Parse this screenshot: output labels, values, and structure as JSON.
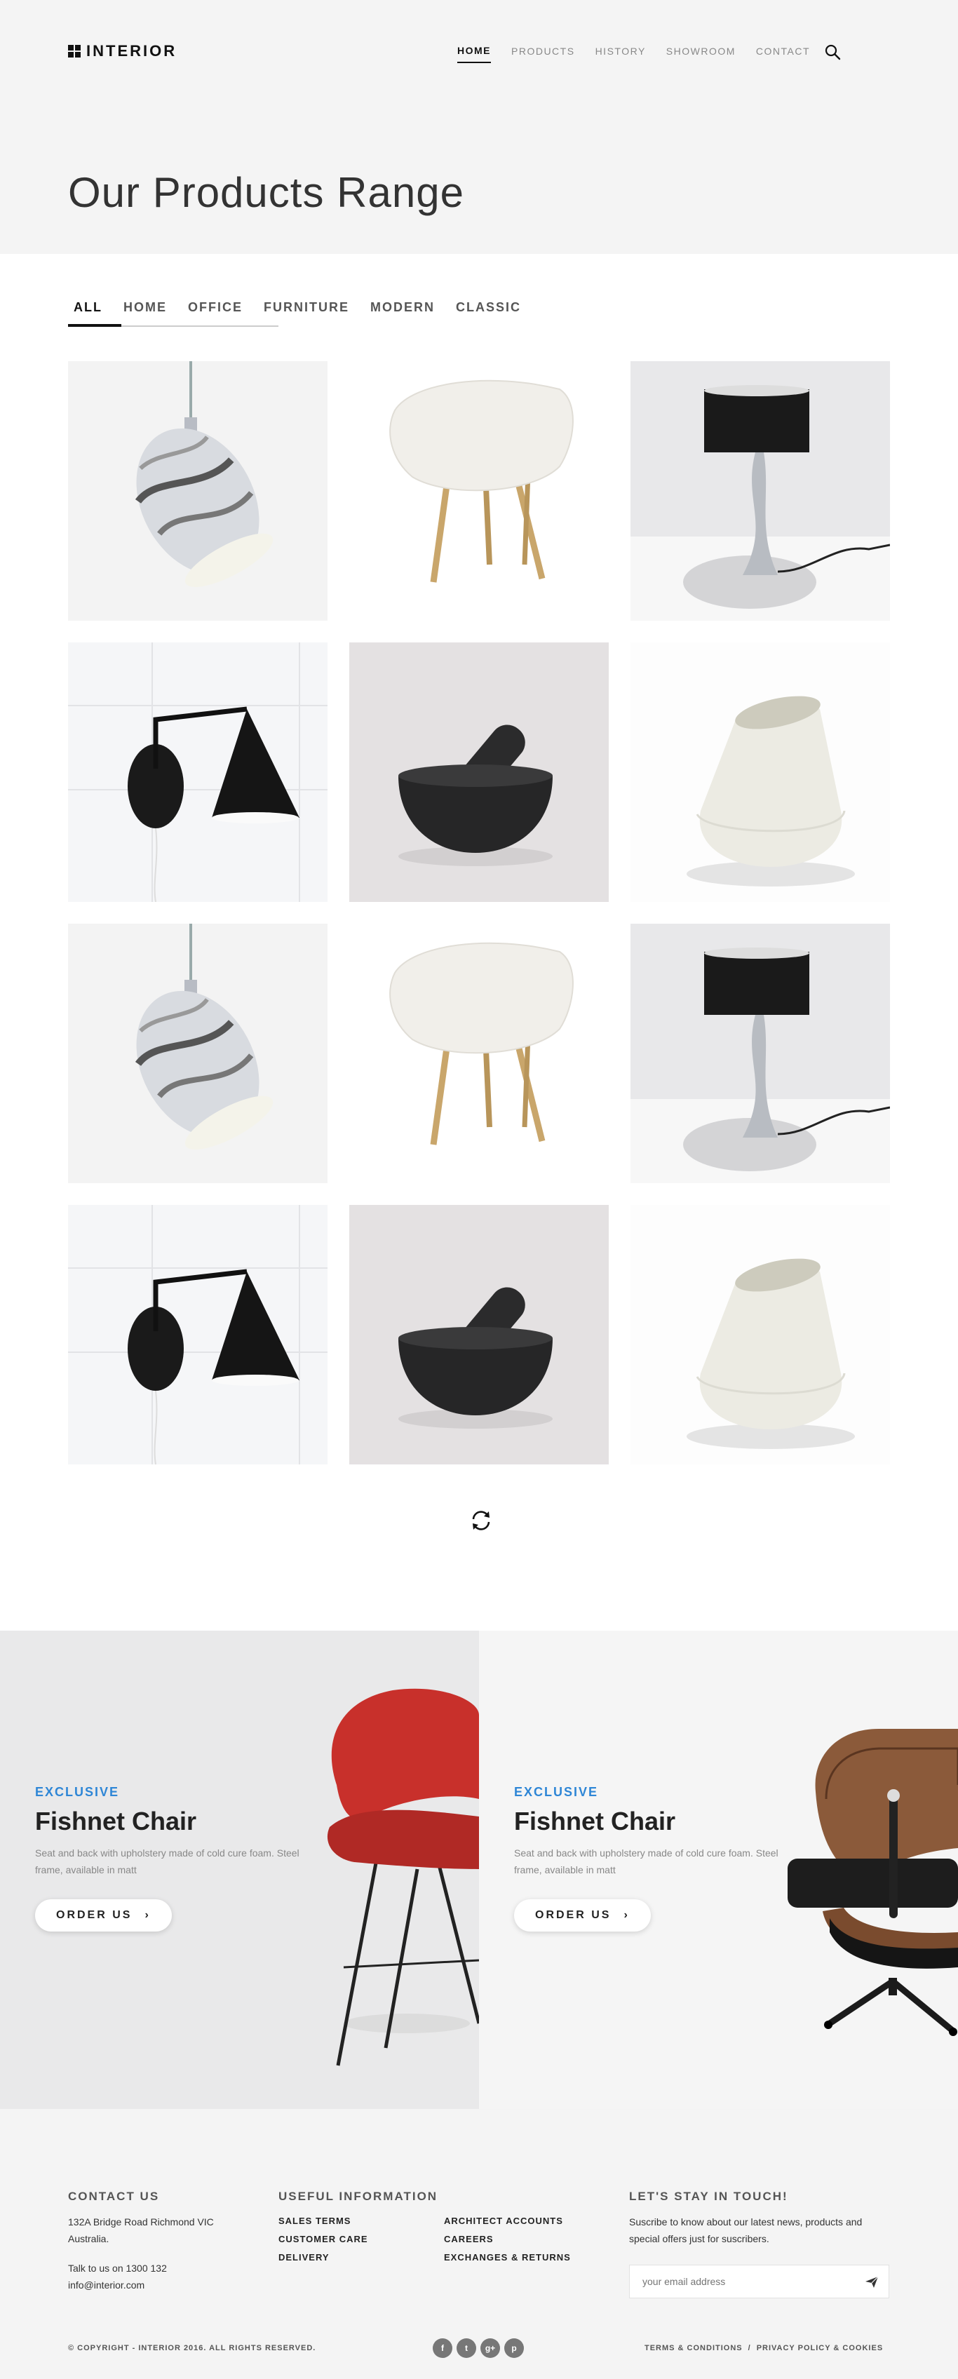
{
  "brand": {
    "name": "INTERIOR"
  },
  "nav": [
    {
      "label": "HOME",
      "active": true
    },
    {
      "label": "PRODUCTS"
    },
    {
      "label": "HISTORY"
    },
    {
      "label": "SHOWROOM"
    },
    {
      "label": "CONTACT"
    }
  ],
  "page": {
    "title": "Our Products Range"
  },
  "filters": [
    "ALL",
    "HOME",
    "OFFICE",
    "FURNITURE",
    "MODERN",
    "CLASSIC"
  ],
  "products": [
    {
      "icon": "marble-pendant-lamp"
    },
    {
      "icon": "white-shell-chair"
    },
    {
      "icon": "black-table-lamp"
    },
    {
      "icon": "black-wall-lamp"
    },
    {
      "icon": "stone-mortar-pestle"
    },
    {
      "icon": "white-ceramic-vase"
    },
    {
      "icon": "marble-pendant-lamp"
    },
    {
      "icon": "white-shell-chair"
    },
    {
      "icon": "black-table-lamp"
    },
    {
      "icon": "black-wall-lamp"
    },
    {
      "icon": "stone-mortar-pestle"
    },
    {
      "icon": "white-ceramic-vase"
    }
  ],
  "promos": [
    {
      "eyebrow": "EXCLUSIVE",
      "title": "Fishnet Chair",
      "desc": "Seat and back with upholstery made of cold cure foam. Steel frame, available in matt",
      "button": "ORDER US"
    },
    {
      "eyebrow": "EXCLUSIVE",
      "title": "Fishnet Chair",
      "desc": "Seat and back with upholstery made of cold cure foam. Steel frame, available in matt",
      "button": "ORDER US"
    }
  ],
  "footer": {
    "contact": {
      "heading": "CONTACT US",
      "address": "132A Bridge Road Richmond VIC Australia.",
      "phone": "Talk to us on 1300 132",
      "email": "info@interior.com"
    },
    "useful": {
      "heading": "USEFUL INFORMATION",
      "col1": [
        "SALES TERMS",
        "CUSTOMER CARE",
        "DELIVERY"
      ],
      "col2": [
        "ARCHITECT ACCOUNTS",
        "CAREERS",
        "EXCHANGES & RETURNS"
      ]
    },
    "newsletter": {
      "heading": "LET'S STAY IN TOUCH!",
      "text": "Suscribe to know about our latest news, products and special offers just for suscribers.",
      "placeholder": "your email address"
    },
    "copyright": "© COPYRIGHT - INTERIOR 2016. ALL RIGHTS RESERVED.",
    "socials": [
      "f",
      "t",
      "g+",
      "p"
    ],
    "legal": [
      "TERMS & CONDITIONS",
      "/",
      "PRIVACY POLICY & COOKIES"
    ]
  },
  "colors": {
    "accent": "#2e86d6",
    "header_bg": "#f4f4f4",
    "promo_left_bg": "#e9e9ea",
    "promo_right_bg": "#f5f5f5"
  }
}
